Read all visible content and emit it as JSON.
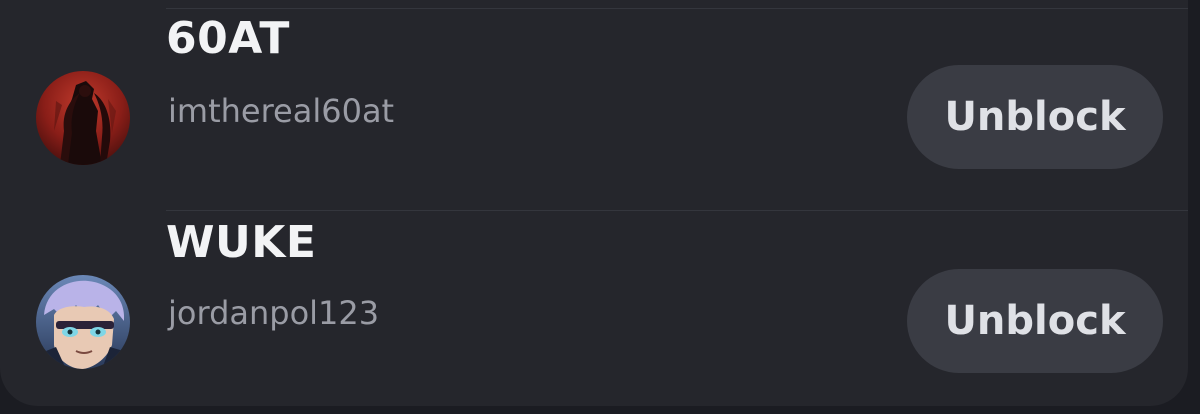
{
  "blocked_users": [
    {
      "display_name": "60AT",
      "username": "imthereal60at",
      "avatar_icon": "user-avatar-dark-red-warrior",
      "action_label": "Unblock"
    },
    {
      "display_name": "WUKE",
      "username": "jordanpol123",
      "avatar_icon": "user-avatar-anime-character",
      "action_label": "Unblock"
    }
  ],
  "colors": {
    "background": "#1b1c22",
    "panel": "#25262c",
    "button": "#3a3c44",
    "display_name": "#f2f3f5",
    "username": "#9a9ca5"
  }
}
